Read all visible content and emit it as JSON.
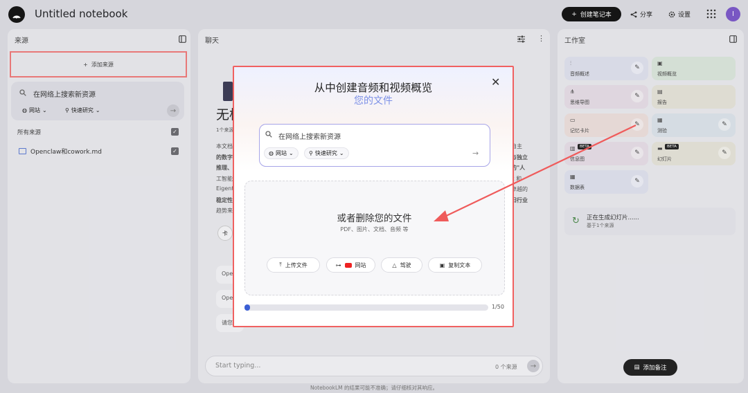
{
  "header": {
    "title": "Untitled notebook",
    "create_label": "创建笔记本",
    "share_label": "分享",
    "settings_label": "设置",
    "avatar_initial": "I"
  },
  "sources": {
    "heading": "来源",
    "add_label": "添加来源",
    "search_placeholder": "在网络上搜索新资源",
    "chip_web": "网站",
    "chip_research": "快速研究",
    "all_sources": "所有来源",
    "file_name": "Openclaw和cowork.md"
  },
  "chat": {
    "heading": "聊天",
    "title_fragment": "无标",
    "count_fragment": "1个来源",
    "body_left": [
      "本文档",
      "的数字",
      "推理、",
      "工智能",
      "Eigent",
      "稳定性",
      "趋势来"
    ],
    "body_right": [
      "自主",
      "与独立",
      "的\"人",
      "k 和",
      "卓越的",
      "旧行业"
    ],
    "pin_fragment": "卡",
    "suggestions": [
      "Ope",
      "Ope",
      "请您"
    ],
    "input_placeholder": "Start typing...",
    "source_count": "0 个来源"
  },
  "studio": {
    "heading": "工作室",
    "tiles": [
      {
        "label": "音频概述",
        "icon": "waveform-icon",
        "color": "#dfe1ee"
      },
      {
        "label": "视频概览",
        "icon": "video-icon",
        "color": "#dbe6dc"
      },
      {
        "label": "思维导图",
        "icon": "mindmap-icon",
        "color": "#e6dde6"
      },
      {
        "label": "报告",
        "icon": "report-icon",
        "color": "#e5e3d8"
      },
      {
        "label": "记忆卡片",
        "icon": "flashcard-icon",
        "color": "#ecdfdc"
      },
      {
        "label": "测验",
        "icon": "quiz-icon",
        "color": "#dce3ea"
      },
      {
        "label": "信息图",
        "icon": "infographic-icon",
        "color": "#e6dde6",
        "beta": "BETA"
      },
      {
        "label": "幻灯片",
        "icon": "slides-icon",
        "color": "#e5e3d8",
        "beta": "BETA"
      },
      {
        "label": "数据表",
        "icon": "table-icon",
        "color": "#dfe1ee"
      }
    ],
    "generating_title": "正在生成幻灯片......",
    "generating_sub": "基于1个来源",
    "add_note_label": "添加备注"
  },
  "footer_note": "NotebookLM 的结果可能不准确；请仔细核对其响应。",
  "modal": {
    "title": "从中创建音频和视频概览",
    "subtitle": "您的文件",
    "search_placeholder": "在网络上搜索新资源",
    "chip_web": "网站",
    "chip_research": "快速研究",
    "drop_title": "或者删除您的文件",
    "drop_sub": "PDF、图片、文档、音频 等",
    "btn_upload": "上传文件",
    "btn_website": "网站",
    "btn_drive": "驾驶",
    "btn_copy": "复制文本",
    "progress_value": 1,
    "progress_max": 50,
    "progress_text": "1/50"
  },
  "colors": {
    "accent_red": "#f06060",
    "progress_blue": "#3b5fd4",
    "subtitle_blue": "#7b8fe6"
  }
}
